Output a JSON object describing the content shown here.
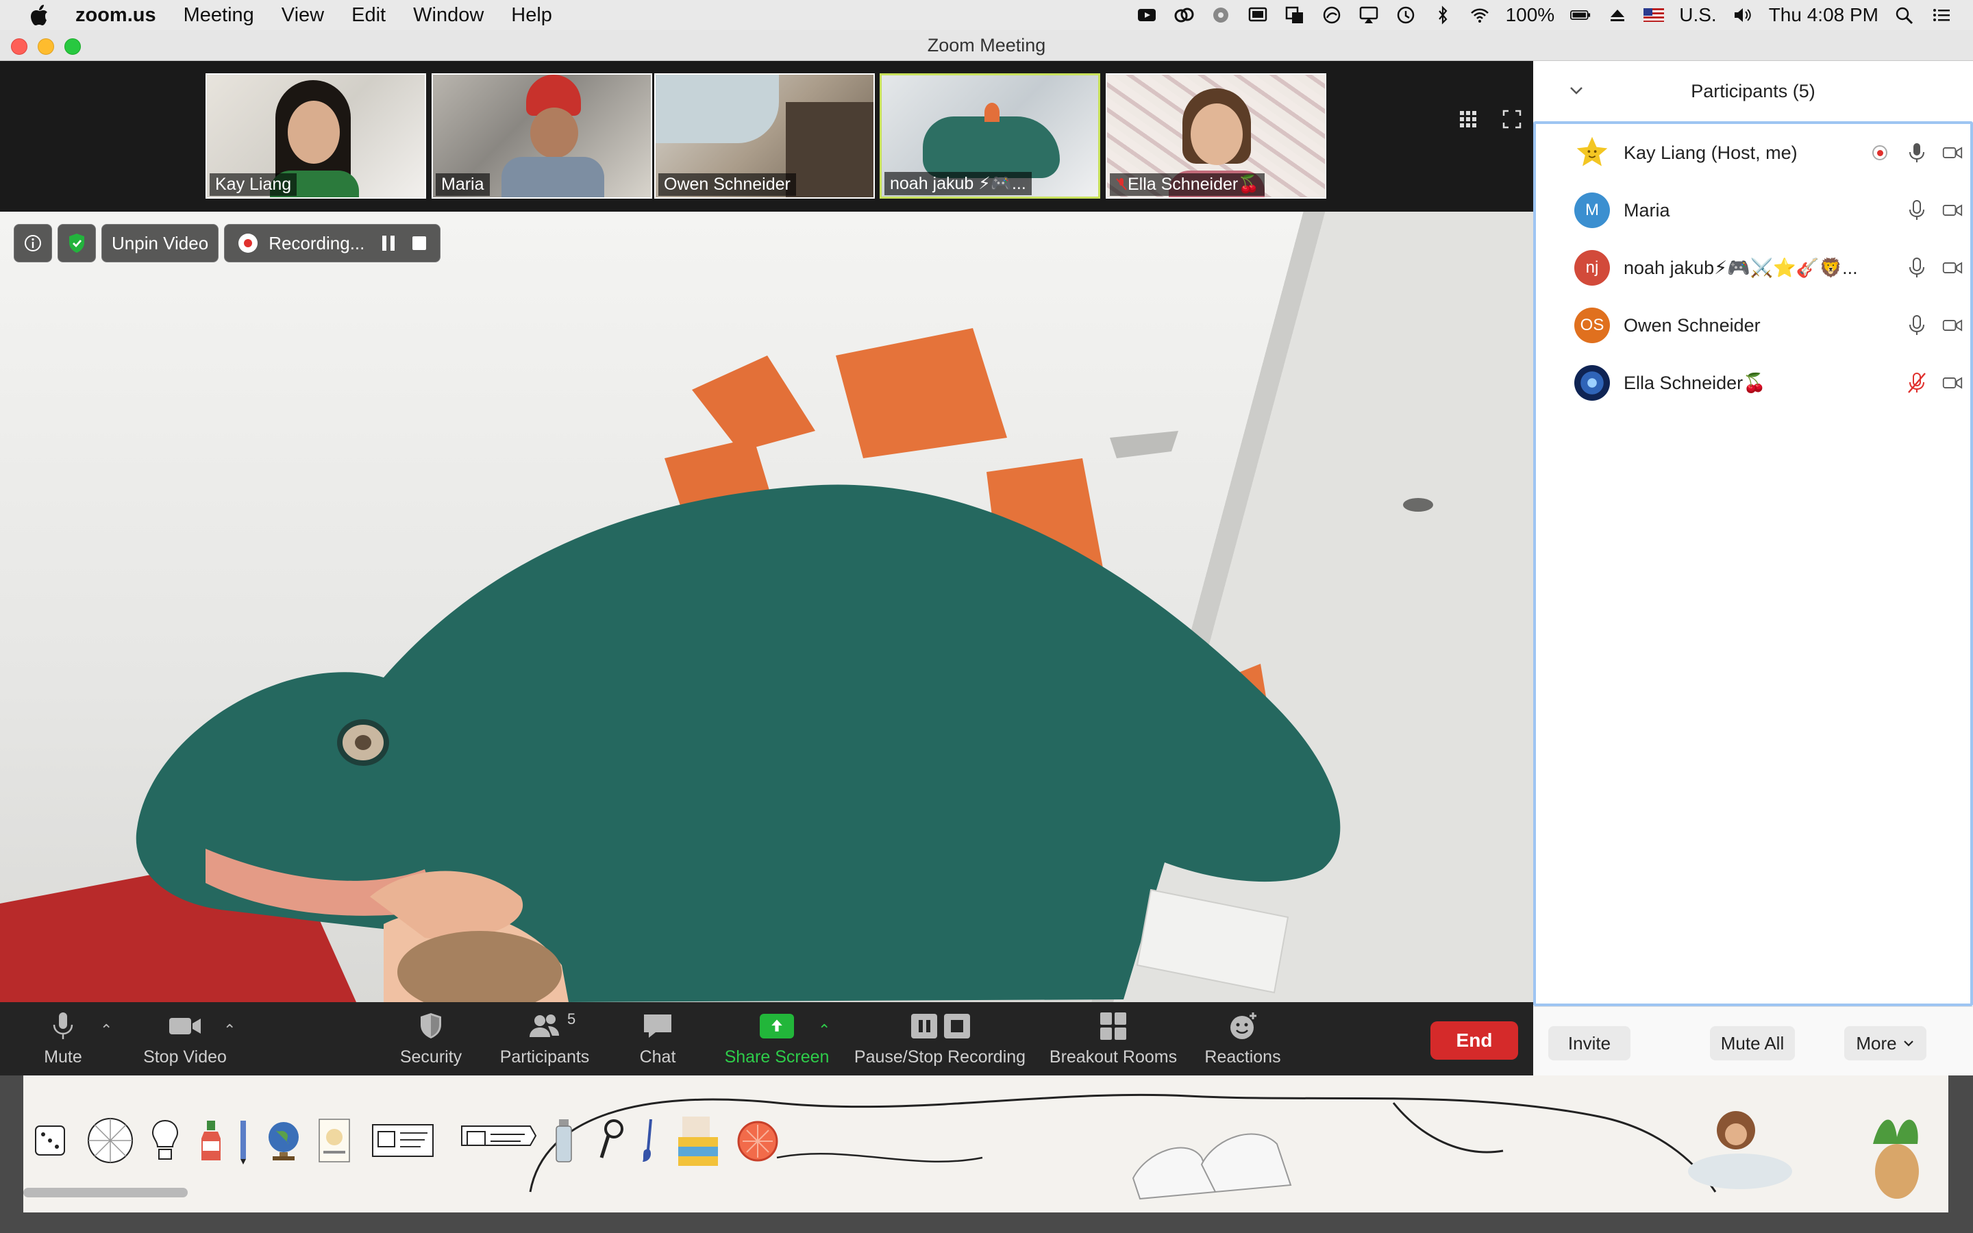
{
  "menubar": {
    "app_name": "zoom.us",
    "menus": [
      "Meeting",
      "View",
      "Edit",
      "Window",
      "Help"
    ],
    "battery": "100%",
    "input_source": "U.S.",
    "clock": "Thu 4:08 PM"
  },
  "window": {
    "title": "Zoom Meeting"
  },
  "thumbnails": [
    {
      "name": "Kay Liang"
    },
    {
      "name": "Maria"
    },
    {
      "name": "Owen Schneider"
    },
    {
      "name": "noah jakub ⚡🎮..."
    },
    {
      "name": "Ella Schneider🍒"
    }
  ],
  "overlay": {
    "unpin_label": "Unpin Video",
    "recording_label": "Recording..."
  },
  "toolbar": {
    "mute": "Mute",
    "stop_video": "Stop Video",
    "security": "Security",
    "participants": "Participants",
    "participants_count": "5",
    "chat": "Chat",
    "share_screen": "Share Screen",
    "pause_stop_recording": "Pause/Stop Recording",
    "breakout_rooms": "Breakout Rooms",
    "reactions": "Reactions",
    "end": "End"
  },
  "panel": {
    "title": "Participants (5)",
    "participants": [
      {
        "name": "Kay Liang (Host, me)",
        "initials": "",
        "avatar_color": "#f3c623",
        "muted": false,
        "recording": true
      },
      {
        "name": "Maria",
        "initials": "M",
        "avatar_color": "#3b8fd0",
        "muted": false,
        "recording": false
      },
      {
        "name": "noah jakub⚡🎮⚔️⭐🎸🦁...",
        "initials": "nj",
        "avatar_color": "#d24a3a",
        "muted": false,
        "recording": false
      },
      {
        "name": "Owen Schneider",
        "initials": "OS",
        "avatar_color": "#e0701e",
        "muted": false,
        "recording": false
      },
      {
        "name": "Ella Schneider🍒",
        "initials": "",
        "avatar_color": "#1c3f8a",
        "muted": true,
        "recording": false
      }
    ],
    "footer": {
      "invite": "Invite",
      "mute_all": "Mute All",
      "more": "More"
    }
  },
  "colors": {
    "accent_green": "#22b63a",
    "end_red": "#d52a2a",
    "panel_border": "#9ec5f2",
    "mute_red": "#e0302d"
  }
}
